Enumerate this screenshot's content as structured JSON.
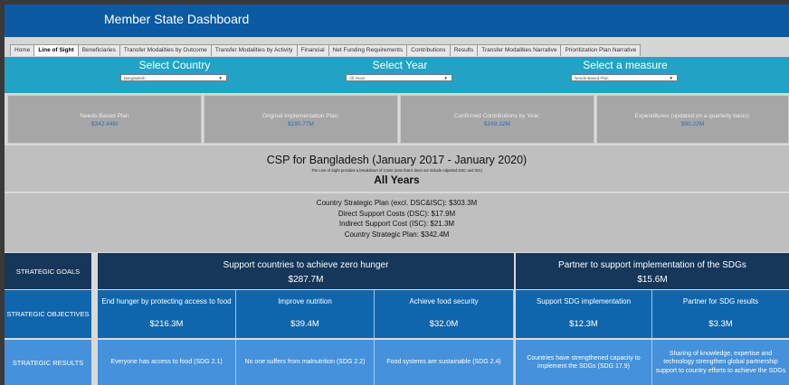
{
  "app": {
    "title": "Member State Dashboard"
  },
  "tabs": [
    "Home",
    "Line of Sight",
    "Beneficiaries",
    "Transfer Modalities by Outcome",
    "Transfer Modalities by Activity",
    "Financial",
    "Net Funding Requirements",
    "Contributions",
    "Results",
    "Transfer Modalities Narrative",
    "Prioritization Plan Narrative"
  ],
  "active_tab": "Line of Sight",
  "selectors": {
    "country": {
      "label": "Select Country",
      "value": "Bangladesh"
    },
    "year": {
      "label": "Select Year",
      "value": "All Years"
    },
    "measure": {
      "label": "Select a measure",
      "value": "Needs-Based Plan"
    }
  },
  "kpis": [
    {
      "label": "Needs-Based Plan",
      "value": "$342.44M"
    },
    {
      "label": "Original Implementation Plan:",
      "value": "$190.77M"
    },
    {
      "label": "Confirmed Contributions by Year:",
      "value": "$169.32M"
    },
    {
      "label": "Expenditures (updated on a quarterly basis):",
      "value": "$90.22M"
    }
  ],
  "csp": {
    "title": "CSP for Bangladesh (January 2017 - January 2020)",
    "note": "The Line of Sight provides a breakdown of Costs (note that it does not include Adjusted DSC and ISC)",
    "years": "All Years"
  },
  "costs": [
    "Country Strategic Plan  (excl. DSC&ISC): $303.3M",
    "Direct Support Costs (DSC): $17.9M",
    "Indirect Support Cost (ISC): $21.3M",
    "Country Strategic Plan: $342.4M"
  ],
  "row_labels": {
    "goals": "STRATEGIC GOALS",
    "objectives": "STRATEGIC OBJECTIVES",
    "results": "STRATEGIC RESULTS"
  },
  "goals": [
    {
      "title": "Support countries to achieve zero hunger",
      "amount": "$287.7M"
    },
    {
      "title": "Partner to support implementation of the SDGs",
      "amount": "$15.6M"
    }
  ],
  "objectives": [
    {
      "title": "End hunger by protecting access to food",
      "amount": "$216.3M"
    },
    {
      "title": "Improve nutrition",
      "amount": "$39.4M"
    },
    {
      "title": "Achieve food security",
      "amount": "$32.0M"
    },
    {
      "title": "Support SDG implementation",
      "amount": "$12.3M"
    },
    {
      "title": "Partner for SDG results",
      "amount": "$3.3M"
    }
  ],
  "results": [
    "Everyone has access to food (SDG 2.1)",
    "No one suffers from malnutrition (SDG 2.2)",
    "Food systems are sustainable (SDG 2.4)",
    "Countries have strengthened capacity to implement the SDGs (SDG 17.9)",
    "Sharing of knowledge, expertise and technology strengthen global partnership support to country efforts to achieve the SDGs"
  ],
  "colors": {
    "header": "#0b5aa2",
    "selector_band": "#22a3c5",
    "kpi_tile": "#a6a6a6",
    "goals_row": "#16375a",
    "objectives_row": "#1066ad",
    "results_row": "#4591db"
  }
}
